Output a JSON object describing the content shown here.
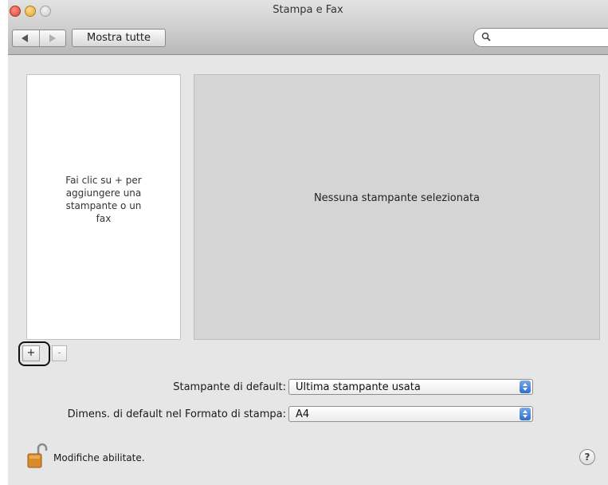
{
  "window": {
    "title": "Stampa e Fax"
  },
  "toolbar": {
    "back_icon": "back-arrow-icon",
    "forward_icon": "forward-arrow-icon",
    "show_all_label": "Mostra tutte",
    "search": {
      "placeholder": "",
      "icon": "magnifier-icon"
    }
  },
  "printer_list": {
    "empty_hint": "Fai clic su + per\naggiungere una\nstampante o un\nfax"
  },
  "detail": {
    "message": "Nessuna stampante selezionata"
  },
  "list_controls": {
    "add_label": "+",
    "remove_label": "-"
  },
  "settings": {
    "default_printer": {
      "label": "Stampante di default:",
      "value": "Ultima stampante usata"
    },
    "default_paper_size": {
      "label": "Dimens. di default nel Formato di stampa:",
      "value": "A4"
    }
  },
  "footer": {
    "lock_icon": "lock-open-icon",
    "lock_text": "Modifiche abilitate.",
    "help_label": "?"
  },
  "colors": {
    "popup_arrows": "#2f6fd0",
    "close_button": "#d9423a",
    "minimize_button": "#e0a53a",
    "lock_body": "#d98a2b"
  }
}
